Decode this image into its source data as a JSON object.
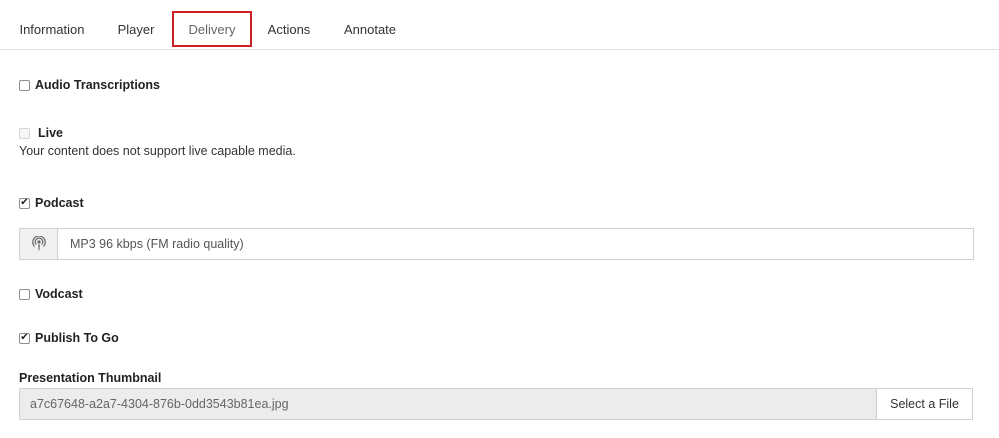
{
  "tabs": [
    {
      "label": "Information"
    },
    {
      "label": "Player"
    },
    {
      "label": "Delivery",
      "active": true
    },
    {
      "label": "Actions"
    },
    {
      "label": "Annotate"
    }
  ],
  "options": {
    "audio_transcriptions": {
      "label": "Audio Transcriptions",
      "checked": false
    },
    "live": {
      "label": "Live",
      "checked": false,
      "disabled": true,
      "note": "Your content does not support live capable media."
    },
    "podcast": {
      "label": "Podcast",
      "checked": true,
      "icon": "podcast-icon",
      "value": "MP3 96 kbps (FM radio quality)"
    },
    "vodcast": {
      "label": "Vodcast",
      "checked": false
    },
    "publish_to_go": {
      "label": "Publish To Go",
      "checked": true
    }
  },
  "thumbnail": {
    "label": "Presentation Thumbnail",
    "file_name": "a7c67648-a2a7-4304-876b-0dd3543b81ea.jpg",
    "button_label": "Select a File"
  },
  "colors": {
    "active_tab_border": "#cc1f1f"
  }
}
